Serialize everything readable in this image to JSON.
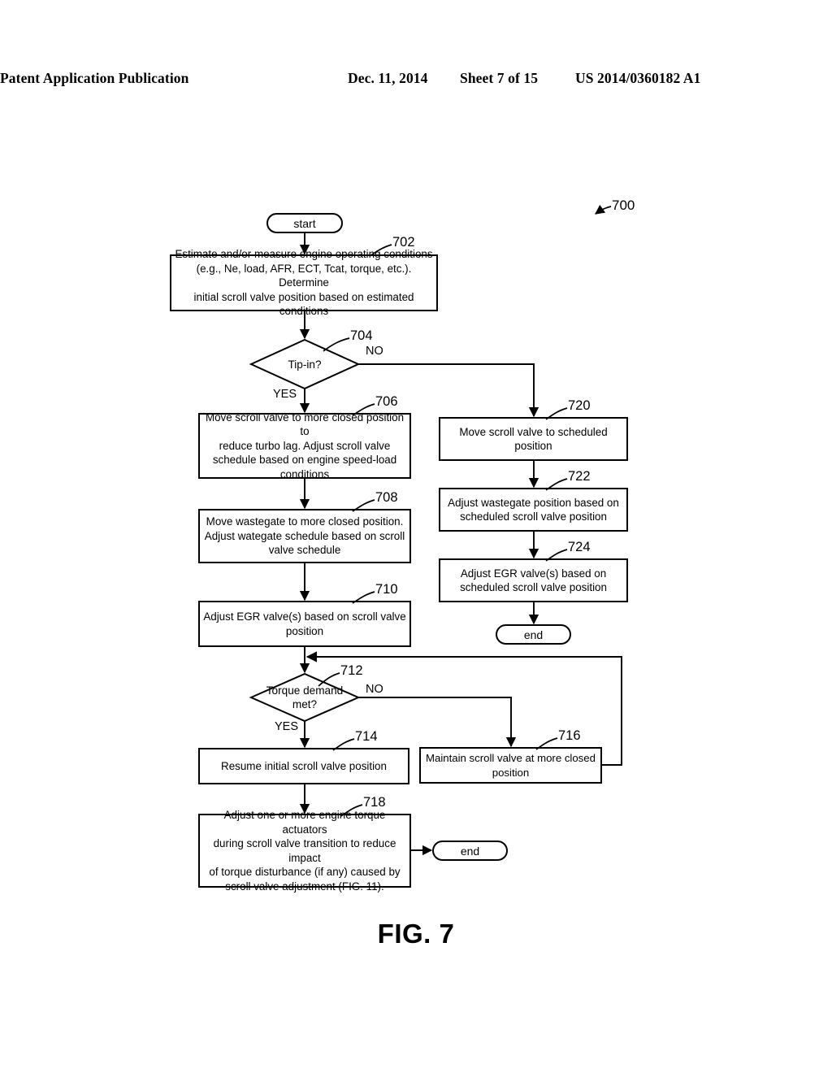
{
  "header": {
    "publication": "Patent Application Publication",
    "date": "Dec. 11, 2014",
    "sheet": "Sheet 7 of 15",
    "patent_number": "US 2014/0360182 A1"
  },
  "figure": {
    "caption": "FIG. 7",
    "diagram_ref": "700"
  },
  "nodes": {
    "start": {
      "label": "start",
      "type": "terminator"
    },
    "n702": {
      "ref": "702",
      "type": "process",
      "text": "Estimate and/or measure engine operating conditions (e.g., Ne, load, AFR, ECT, Tcat, torque, etc.). Determine initial scroll valve position based on estimated conditions",
      "lines": [
        "Estimate and/or measure engine operating conditions",
        "(e.g., Ne, load, AFR, ECT, Tcat, torque, etc.). Determine",
        "initial scroll valve position based on estimated conditions"
      ]
    },
    "n704": {
      "ref": "704",
      "type": "decision",
      "text": "Tip-in?",
      "yes_label": "YES",
      "no_label": "NO"
    },
    "n706": {
      "ref": "706",
      "type": "process",
      "text": "Move scroll valve to more closed position to reduce turbo lag. Adjust scroll valve schedule based on engine speed-load conditions",
      "lines": [
        "Move scroll valve to more closed position to",
        "reduce turbo lag. Adjust scroll valve",
        "schedule based on engine speed-load",
        "conditions"
      ]
    },
    "n708": {
      "ref": "708",
      "type": "process",
      "text": "Move wastegate to more closed position. Adjust wategate schedule based on scroll valve schedule",
      "lines": [
        "Move wastegate to more closed position.",
        "Adjust wategate schedule based on scroll",
        "valve schedule"
      ]
    },
    "n710": {
      "ref": "710",
      "type": "process",
      "text": "Adjust EGR valve(s) based on scroll valve position",
      "lines": [
        "Adjust EGR valve(s) based on scroll valve",
        "position"
      ]
    },
    "n712": {
      "ref": "712",
      "type": "decision",
      "text": "Torque demand met?",
      "lines": [
        "Torque demand",
        "met?"
      ],
      "yes_label": "YES",
      "no_label": "NO"
    },
    "n714": {
      "ref": "714",
      "type": "process",
      "text": "Resume initial scroll valve position",
      "lines": [
        "Resume initial scroll valve position"
      ]
    },
    "n716": {
      "ref": "716",
      "type": "process",
      "text": "Maintain scroll valve at more closed position",
      "lines": [
        "Maintain scroll valve at more closed",
        "position"
      ]
    },
    "n718": {
      "ref": "718",
      "type": "process",
      "text": "Adjust one or more engine torque actuators during scroll valve transition to reduce impact of torque disturbance (if any) caused by scroll valve adjustment (FIG. 11).",
      "lines": [
        "Adjust one or more engine torque actuators",
        "during scroll valve transition to reduce impact",
        "of torque disturbance (if any) caused by",
        "scroll valve adjustment (FIG. 11)."
      ]
    },
    "n720": {
      "ref": "720",
      "type": "process",
      "text": "Move scroll valve to scheduled position",
      "lines": [
        "Move scroll valve to scheduled position"
      ]
    },
    "n722": {
      "ref": "722",
      "type": "process",
      "text": "Adjust wastegate position based on scheduled scroll valve position",
      "lines": [
        "Adjust wastegate position based on",
        "scheduled scroll valve position"
      ]
    },
    "n724": {
      "ref": "724",
      "type": "process",
      "text": "Adjust EGR valve(s) based on scheduled scroll valve position",
      "lines": [
        "Adjust EGR valve(s) based on",
        "scheduled scroll valve position"
      ]
    },
    "end_right": {
      "label": "end",
      "type": "terminator"
    },
    "end_bottom": {
      "label": "end",
      "type": "terminator"
    }
  }
}
